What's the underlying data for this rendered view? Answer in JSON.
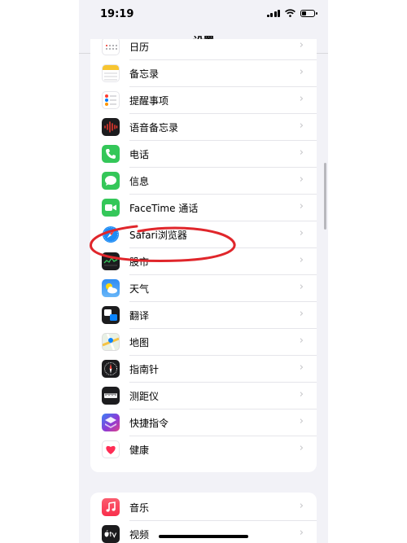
{
  "status_bar": {
    "time": "19:19",
    "battery_level": 0.3
  },
  "header": {
    "title": "设置"
  },
  "group1": [
    {
      "label": "日历",
      "icon": "calendar-icon",
      "color": "#ffffff"
    },
    {
      "label": "备忘录",
      "icon": "notes-icon",
      "color": "#ffffff"
    },
    {
      "label": "提醒事项",
      "icon": "reminders-icon",
      "color": "#ffffff"
    },
    {
      "label": "语音备忘录",
      "icon": "voice-memos-icon",
      "color": "#1c1c1e"
    },
    {
      "label": "电话",
      "icon": "phone-icon",
      "color": "#34c759"
    },
    {
      "label": "信息",
      "icon": "messages-icon",
      "color": "#34c759"
    },
    {
      "label": "FaceTime 通话",
      "icon": "facetime-icon",
      "color": "#34c759"
    },
    {
      "label": "Safari浏览器",
      "icon": "safari-icon",
      "color": "#ffffff"
    },
    {
      "label": "股市",
      "icon": "stocks-icon",
      "color": "#1c1c1e"
    },
    {
      "label": "天气",
      "icon": "weather-icon",
      "color": "#2f8cf2"
    },
    {
      "label": "翻译",
      "icon": "translate-icon",
      "color": "#1c1c1e"
    },
    {
      "label": "地图",
      "icon": "maps-icon",
      "color": "#e9f1e5"
    },
    {
      "label": "指南针",
      "icon": "compass-icon",
      "color": "#1c1c1e"
    },
    {
      "label": "测距仪",
      "icon": "measure-icon",
      "color": "#1c1c1e"
    },
    {
      "label": "快捷指令",
      "icon": "shortcuts-icon",
      "color": "#5b3ad6"
    },
    {
      "label": "健康",
      "icon": "health-icon",
      "color": "#ffffff"
    }
  ],
  "group2": [
    {
      "label": "音乐",
      "icon": "music-icon",
      "color": "#fa3a55"
    },
    {
      "label": "视频",
      "icon": "tv-icon",
      "color": "#1c1c1e"
    }
  ],
  "chevron": "›",
  "annotation_color": "#e0262b"
}
